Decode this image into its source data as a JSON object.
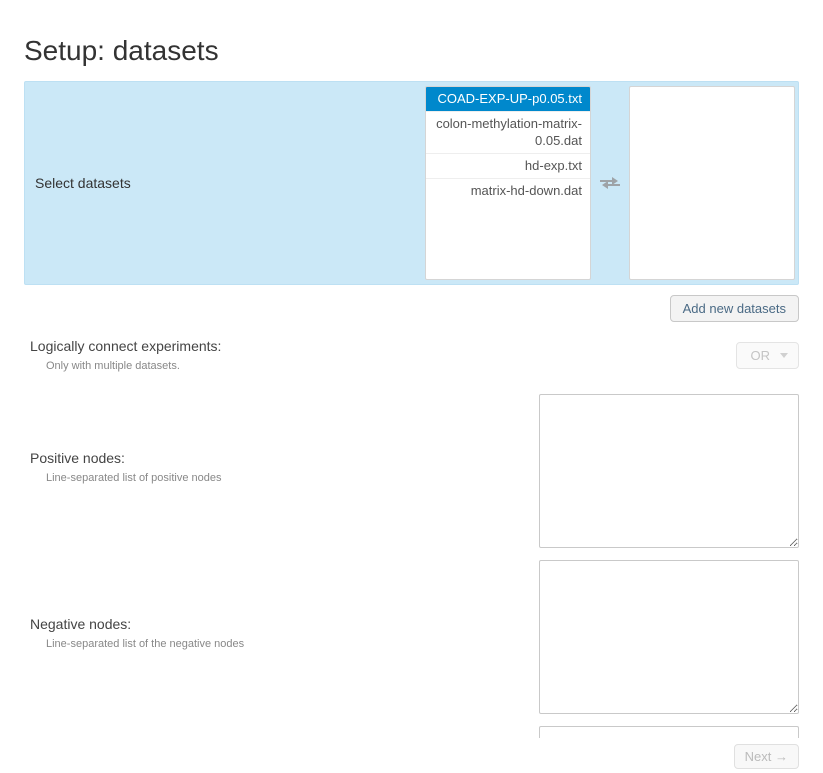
{
  "title": "Setup: datasets",
  "select_panel": {
    "label": "Select datasets",
    "available": [
      {
        "label": "COAD-EXP-UP-p0.05.txt",
        "selected": true
      },
      {
        "label": "colon-methylation-matrix-0.05.dat",
        "selected": false
      },
      {
        "label": "hd-exp.txt",
        "selected": false
      },
      {
        "label": "matrix-hd-down.dat",
        "selected": false
      }
    ],
    "chosen": []
  },
  "add_button": "Add new datasets",
  "logic_row": {
    "label": "Logically connect experiments:",
    "help": "Only with multiple datasets.",
    "selector_value": "OR"
  },
  "positive_row": {
    "label": "Positive nodes:",
    "help": "Line-separated list of positive nodes",
    "value": ""
  },
  "negative_row": {
    "label": "Negative nodes:",
    "help": "Line-separated list of the negative nodes",
    "value": ""
  },
  "next_button": "Next →"
}
